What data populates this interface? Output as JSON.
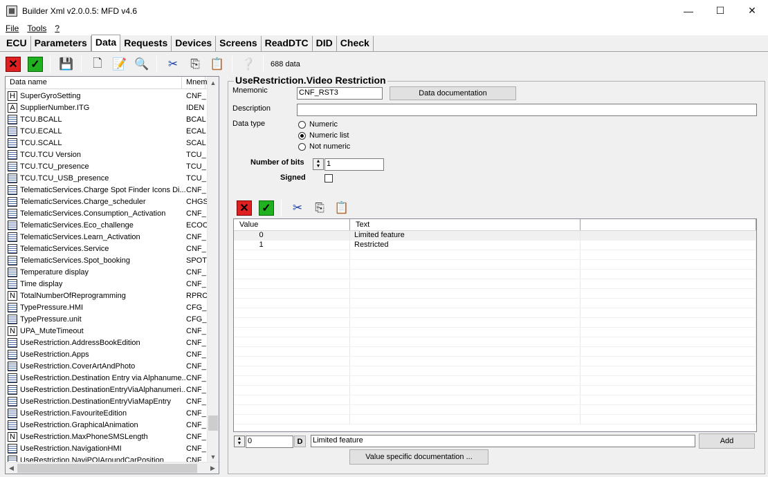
{
  "window": {
    "title": "Builder Xml v2.0.0.5: MFD v4.6",
    "minimize": "—",
    "maximize": "☐",
    "close": "✕"
  },
  "menu": {
    "file": "File",
    "tools": "Tools",
    "help": "?"
  },
  "tabs": [
    "ECU",
    "Parameters",
    "Data",
    "Requests",
    "Devices",
    "Screens",
    "ReadDTC",
    "DID",
    "Check"
  ],
  "active_tab": "Data",
  "toolbar": {
    "icons": [
      "cancel-icon",
      "validate-icon",
      "save-icon",
      "new-data-icon",
      "edit-data-icon",
      "search-icon",
      "cut-icon",
      "copy-icon",
      "paste-icon",
      "help-icon"
    ],
    "data_count": "688 data"
  },
  "data_list": {
    "columns": [
      "Data name",
      "Mnem"
    ],
    "rows": [
      {
        "icon": "H",
        "name": "SuperGyroSetting",
        "mnem": "CNF_"
      },
      {
        "icon": "A",
        "name": "SupplierNumber.ITG",
        "mnem": "IDEN"
      },
      {
        "icon": "list",
        "name": "TCU.BCALL",
        "mnem": "BCAL"
      },
      {
        "icon": "list",
        "name": "TCU.ECALL",
        "mnem": "ECAL"
      },
      {
        "icon": "list",
        "name": "TCU.SCALL",
        "mnem": "SCAL"
      },
      {
        "icon": "list",
        "name": "TCU.TCU Version",
        "mnem": "TCU_"
      },
      {
        "icon": "list",
        "name": "TCU.TCU_presence",
        "mnem": "TCU_"
      },
      {
        "icon": "list",
        "name": "TCU.TCU_USB_presence",
        "mnem": "TCU_"
      },
      {
        "icon": "list",
        "name": "TelematicServices.Charge Spot Finder Icons Di...",
        "mnem": "CNF_"
      },
      {
        "icon": "list",
        "name": "TelematicServices.Charge_scheduler",
        "mnem": "CHGS"
      },
      {
        "icon": "list",
        "name": "TelematicServices.Consumption_Activation",
        "mnem": "CNF_"
      },
      {
        "icon": "list",
        "name": "TelematicServices.Eco_challenge",
        "mnem": "ECOC"
      },
      {
        "icon": "list",
        "name": "TelematicServices.Learn_Activation",
        "mnem": "CNF_"
      },
      {
        "icon": "list",
        "name": "TelematicServices.Service",
        "mnem": "CNF_"
      },
      {
        "icon": "list",
        "name": "TelematicServices.Spot_booking",
        "mnem": "SPOT"
      },
      {
        "icon": "list",
        "name": "Temperature display",
        "mnem": "CNF_"
      },
      {
        "icon": "list",
        "name": "Time display",
        "mnem": "CNF_"
      },
      {
        "icon": "N",
        "name": "TotalNumberOfReprogramming",
        "mnem": "RPRC"
      },
      {
        "icon": "list",
        "name": "TypePressure.HMI",
        "mnem": "CFG_"
      },
      {
        "icon": "list",
        "name": "TypePressure.unit",
        "mnem": "CFG_"
      },
      {
        "icon": "N",
        "name": "UPA_MuteTimeout",
        "mnem": "CNF_"
      },
      {
        "icon": "list",
        "name": "UseRestriction.AddressBookEdition",
        "mnem": "CNF_"
      },
      {
        "icon": "list",
        "name": "UseRestriction.Apps",
        "mnem": "CNF_"
      },
      {
        "icon": "list",
        "name": "UseRestriction.CoverArtAndPhoto",
        "mnem": "CNF_"
      },
      {
        "icon": "list",
        "name": "UseRestriction.Destination Entry via Alphanume...",
        "mnem": "CNF_"
      },
      {
        "icon": "list",
        "name": "UseRestriction.DestinationEntryViaAlphanumeri...",
        "mnem": "CNF_"
      },
      {
        "icon": "list",
        "name": "UseRestriction.DestinationEntryViaMapEntry",
        "mnem": "CNF_"
      },
      {
        "icon": "list",
        "name": "UseRestriction.FavouriteEdition",
        "mnem": "CNF_"
      },
      {
        "icon": "list",
        "name": "UseRestriction.GraphicalAnimation",
        "mnem": "CNF_"
      },
      {
        "icon": "N",
        "name": "UseRestriction.MaxPhoneSMSLength",
        "mnem": "CNF_"
      },
      {
        "icon": "list",
        "name": "UseRestriction.NavigationHMI",
        "mnem": "CNF_"
      },
      {
        "icon": "list",
        "name": "UseRestriction.NaviPOIAroundCarPosition",
        "mnem": "CNF_"
      }
    ]
  },
  "detail": {
    "group_title": "UseRestriction.Video Restriction",
    "mnemonic_label": "Mnemonic",
    "mnemonic_value": "CNF_RST3",
    "data_doc_button": "Data documentation",
    "description_label": "Description",
    "description_value": "",
    "data_type_label": "Data type",
    "data_type_options": [
      "Numeric",
      "Numeric list",
      "Not numeric"
    ],
    "data_type_selected": "Numeric list",
    "number_of_bits_label": "Number of bits",
    "number_of_bits_value": "1",
    "signed_label": "Signed",
    "signed_checked": false
  },
  "values_grid": {
    "columns": [
      "Value",
      "Text",
      ""
    ],
    "rows": [
      {
        "value": "0",
        "text": "Limited feature"
      },
      {
        "value": "1",
        "text": "Restricted"
      }
    ]
  },
  "value_editor": {
    "value": "0",
    "d_button": "D",
    "text": "Limited feature",
    "add_button": "Add",
    "value_doc_button": "Value specific documentation ..."
  }
}
